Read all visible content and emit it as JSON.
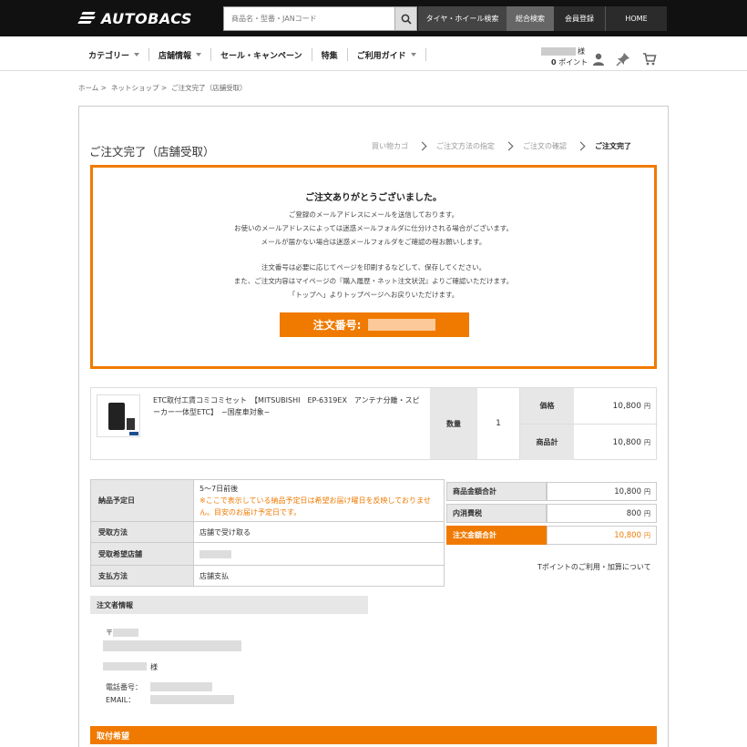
{
  "header": {
    "logo_text": "AUTOBACS",
    "search_placeholder": "商品名・型番・JANコード",
    "nav_tire": "タイヤ・ホイール検索",
    "nav_all": "総合検索",
    "nav_member": "会員登録",
    "nav_home": "HOME"
  },
  "subnav": {
    "items": [
      {
        "label": "カテゴリー",
        "dropdown": true
      },
      {
        "label": "店舗情報",
        "dropdown": true
      },
      {
        "label": "セール・キャンペーン",
        "dropdown": false
      },
      {
        "label": "特集",
        "dropdown": false
      },
      {
        "label": "ご利用ガイド",
        "dropdown": true
      }
    ],
    "user_suffix": "様",
    "points_value": "0",
    "points_unit": "ポイント",
    "icons": [
      "user-icon",
      "pin-icon",
      "cart-icon"
    ]
  },
  "breadcrumb": [
    "ホーム >",
    "ネットショップ >",
    "ご注文完了（店舗受取）"
  ],
  "page": {
    "title": "ご注文完了（店舗受取）",
    "steps": [
      "買い物カゴ",
      "ご注文方法の指定",
      "ご注文の確認",
      "ご注文完了"
    ],
    "active_step_index": 3
  },
  "thanks": {
    "title": "ご注文ありがとうございました。",
    "para1": [
      "ご登録のメールアドレスにメールを送信しております。",
      "お使いのメールアドレスによっては迷惑メールフォルダに仕分けされる場合がございます。",
      "メールが届かない場合は迷惑メールフォルダをご確認の程お願いします。"
    ],
    "para2": [
      "注文番号は必要に応じてページを印刷するなどして、保存してください。",
      "また、ご注文内容はマイページの『購入履歴・ネット注文状況』よりご確認いただけます。",
      "「トップへ」よりトップページへお戻りいただけます。"
    ],
    "order_label": "注文番号:"
  },
  "product": {
    "name": "ETC取付工賃コミコミセット　【MITSUBISHI　EP-6319EX　アンテナ分離・スピーカー一体型ETC】　~国産車対象~",
    "qty_label": "数量",
    "qty": "1",
    "price_label": "価格",
    "price": "10,800",
    "subtotal_label": "商品計",
    "subtotal": "10,800",
    "yen": "円"
  },
  "info": {
    "delivery_label": "納品予定日",
    "delivery_value": "5〜7日前後",
    "delivery_note": "※ここで表示している納品予定日は希望お届け曜日を反映しておりません。目安のお届け予定日です。",
    "receive_label": "受取方法",
    "receive_value": "店舗で受け取る",
    "store_label": "受取希望店舗",
    "pay_label": "支払方法",
    "pay_value": "店舗支払"
  },
  "totals": {
    "goods_label": "商品金額合計",
    "goods_value": "10,800",
    "tax_label": "内消費税",
    "tax_value": "800",
    "grand_label": "注文金額合計",
    "grand_value": "10,800",
    "yen": "円",
    "point_link": "Tポイントのご利用・加算について"
  },
  "orderer": {
    "heading": "注文者情報",
    "name_suffix": "様",
    "phone_label": "電話番号：",
    "email_label": "EMAIL：",
    "postal_prefix": "〒"
  },
  "install": {
    "heading": "取付希望"
  },
  "colors": {
    "accent": "#f07a00",
    "header_bg": "#111111",
    "label_bg": "#e7e7e7"
  }
}
